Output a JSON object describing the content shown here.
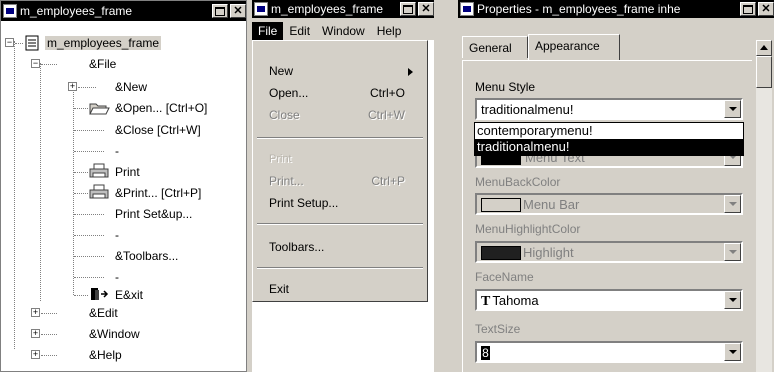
{
  "tree_window": {
    "title": "m_employees_frame",
    "root": "m_employees_frame",
    "items": [
      {
        "label": "&File",
        "expander": "−"
      },
      {
        "label": "&New",
        "expander": "+"
      },
      {
        "label": "&Open...  [Ctrl+O]"
      },
      {
        "label": "&Close  [Ctrl+W]"
      },
      {
        "label": "-"
      },
      {
        "label": "Print"
      },
      {
        "label": "&Print...  [Ctrl+P]"
      },
      {
        "label": "Print Set&up..."
      },
      {
        "label": "-"
      },
      {
        "label": "&Toolbars..."
      },
      {
        "label": "-"
      },
      {
        "label": "E&xit"
      },
      {
        "label": "&Edit",
        "expander": "+"
      },
      {
        "label": "&Window",
        "expander": "+"
      },
      {
        "label": "&Help",
        "expander": "+"
      }
    ]
  },
  "menu_window": {
    "title": "m_employees_frame",
    "menubar": [
      "File",
      "Edit",
      "Window",
      "Help"
    ],
    "items": {
      "new": "New",
      "open": "Open...",
      "open_accel": "Ctrl+O",
      "close": "Close",
      "close_accel": "Ctrl+W",
      "print_faint": "Print",
      "print": "Print...",
      "print_accel": "Ctrl+P",
      "print_setup": "Print Setup...",
      "toolbars": "Toolbars...",
      "exit": "Exit"
    }
  },
  "properties_window": {
    "title": "Properties - m_employees_frame inhe",
    "tabs": [
      "General",
      "Appearance"
    ],
    "menu_style_label": "Menu Style",
    "menu_style_value": "traditionalmenu!",
    "menu_style_options": [
      "contemporarymenu!",
      "traditionalmenu!"
    ],
    "menu_text_value": "Menu Text",
    "menu_back_color_label": "MenuBackColor",
    "menu_back_color_value": "Menu Bar",
    "menu_highlight_color_label": "MenuHighlightColor",
    "menu_highlight_color_value": "Highlight",
    "face_name_label": "FaceName",
    "face_name_value": "Tahoma",
    "text_size_label": "TextSize",
    "text_size_value": "8"
  }
}
